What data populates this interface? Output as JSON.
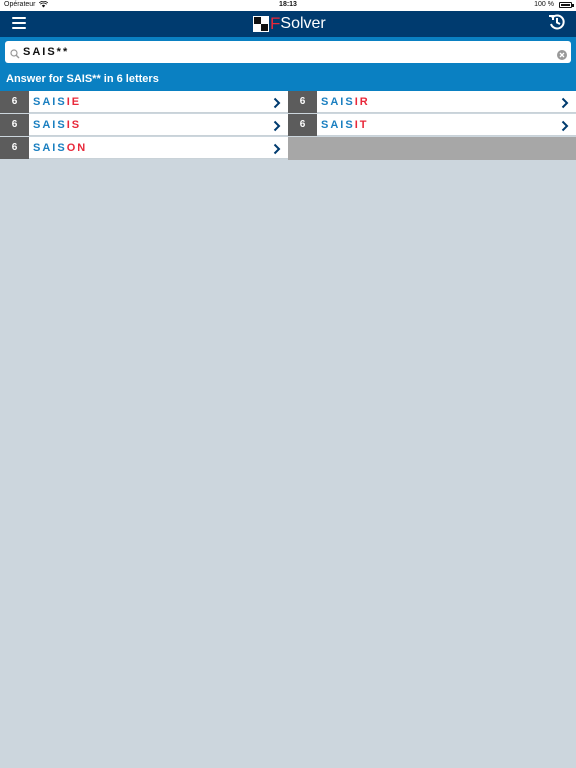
{
  "status_bar": {
    "carrier": "Opérateur",
    "time": "18:13",
    "battery": "100 %"
  },
  "nav": {
    "logo_letter": "F",
    "logo_text": "Solver"
  },
  "search": {
    "value": "SAIS**",
    "placeholder": ""
  },
  "answer_header": "Answer for SAIS** in 6 letters",
  "results": [
    {
      "count": "6",
      "prefix": "SAIS",
      "suffix": "IE"
    },
    {
      "count": "6",
      "prefix": "SAIS",
      "suffix": "IR"
    },
    {
      "count": "6",
      "prefix": "SAIS",
      "suffix": "IS"
    },
    {
      "count": "6",
      "prefix": "SAIS",
      "suffix": "IT"
    },
    {
      "count": "6",
      "prefix": "SAIS",
      "suffix": "ON"
    }
  ],
  "colors": {
    "nav_bg": "#003b6f",
    "accent_blue": "#0a80c2",
    "found_red": "#e8283a",
    "count_bg": "#5c5c5c",
    "page_bg": "#ccd6dd"
  },
  "icons": {
    "menu": "hamburger-menu-icon",
    "history": "history-icon",
    "search": "magnifier-icon",
    "clear": "clear-circle-icon",
    "row": "chevron-right-icon"
  }
}
